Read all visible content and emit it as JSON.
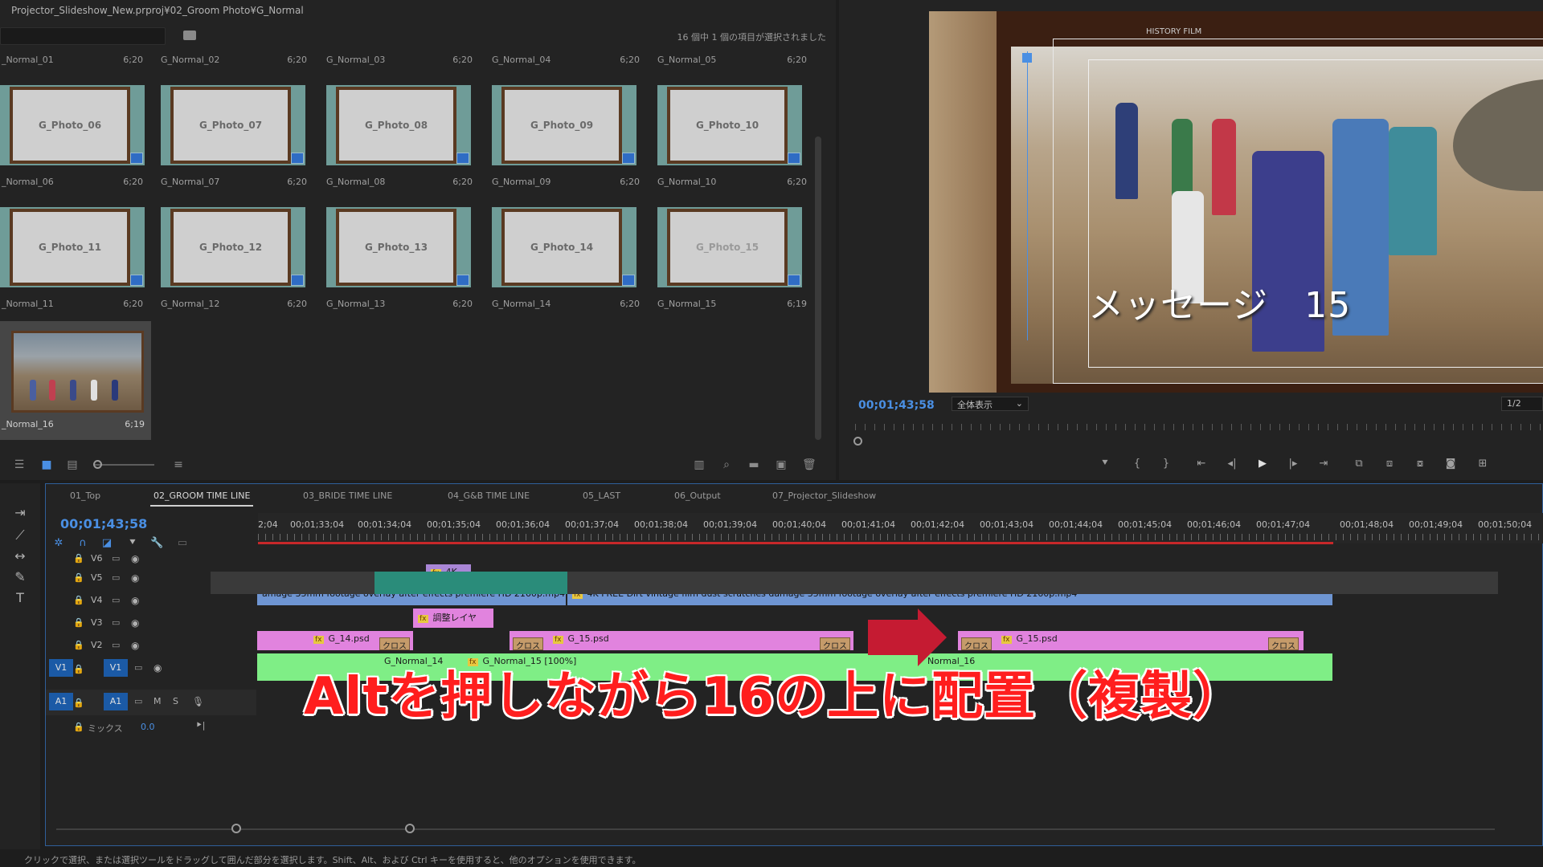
{
  "project": {
    "path": "Projector_Slideshow_New.prproj¥02_Groom Photo¥G_Normal",
    "count_text": "16 個中 1 個の項目が選択されました",
    "header_items": [
      {
        "name": "_Normal_01",
        "dur": "6;20"
      },
      {
        "name": "G_Normal_02",
        "dur": "6;20"
      },
      {
        "name": "G_Normal_03",
        "dur": "6;20"
      },
      {
        "name": "G_Normal_04",
        "dur": "6;20"
      },
      {
        "name": "G_Normal_05",
        "dur": "6;20"
      }
    ],
    "row1": [
      {
        "thumb": "G_Photo_06",
        "name": "_Normal_06",
        "dur": "6;20"
      },
      {
        "thumb": "G_Photo_07",
        "name": "G_Normal_07",
        "dur": "6;20"
      },
      {
        "thumb": "G_Photo_08",
        "name": "G_Normal_08",
        "dur": "6;20"
      },
      {
        "thumb": "G_Photo_09",
        "name": "G_Normal_09",
        "dur": "6;20"
      },
      {
        "thumb": "G_Photo_10",
        "name": "G_Normal_10",
        "dur": "6;20"
      }
    ],
    "row2": [
      {
        "thumb": "G_Photo_11",
        "name": "_Normal_11",
        "dur": "6;20"
      },
      {
        "thumb": "G_Photo_12",
        "name": "G_Normal_12",
        "dur": "6;20"
      },
      {
        "thumb": "G_Photo_13",
        "name": "G_Normal_13",
        "dur": "6;20"
      },
      {
        "thumb": "G_Photo_14",
        "name": "G_Normal_14",
        "dur": "6;20"
      },
      {
        "thumb": "G_Photo_15",
        "name": "G_Normal_15",
        "dur": "6;19"
      }
    ],
    "selected": {
      "name": "_Normal_16",
      "dur": "6;19"
    }
  },
  "monitor": {
    "message": "メッセージ　15",
    "film_title": "HISTORY FILM",
    "timecode": "00;01;43;58",
    "zoom": "全体表示",
    "resolution": "1/2"
  },
  "timeline": {
    "tabs": [
      "01_Top",
      "02_GROOM TIME LINE",
      "03_BRIDE TIME LINE",
      "04_G&B TIME LINE",
      "05_LAST",
      "06_Output",
      "07_Projector_Slideshow"
    ],
    "timecode": "00;01;43;58",
    "ruler": [
      "2;04",
      "00;01;33;04",
      "00;01;34;04",
      "00;01;35;04",
      "00;01;36;04",
      "00;01;37;04",
      "00;01;38;04",
      "00;01;39;04",
      "00;01;40;04",
      "00;01;41;04",
      "00;01;42;04",
      "00;01;43;04",
      "00;01;44;04",
      "00;01;45;04",
      "00;01;46;04",
      "00;01;47;04",
      "00;01;48;04",
      "00;01;49;04",
      "00;01;50;04"
    ],
    "tracks": {
      "v6": "V6",
      "v5": "V5",
      "v4": "V4",
      "v3": "V3",
      "v2": "V2",
      "v1": "V1",
      "a1": "A1",
      "mix_label": "ミックス",
      "mix_value": "0.0"
    },
    "clips": {
      "v6": "4K-",
      "v4a": "amage 35mm footage overlay after effects premiere HD 2160p.mp4",
      "v4b": "4K FREE Dirt vintage film dust scratches damage 35mm footage overlay after effects premiere HD 2160p.mp4",
      "v3": "調整レイヤ",
      "v2a": "G_14.psd",
      "v2b": "G_15.psd",
      "v2c": "G_15.psd",
      "xfade": "クロス",
      "v1a": "G_Normal_14",
      "v1b": "G_Normal_15 [100%]",
      "v1c": "Normal_16"
    },
    "fx_label": "fx",
    "overlay": "Altを押しながら16の上に配置（複製）"
  },
  "status": "クリックで選択、または選択ツールをドラッグして囲んだ部分を選択します。Shift、Alt、および Ctrl キーを使用すると、他のオプションを使用できます。"
}
